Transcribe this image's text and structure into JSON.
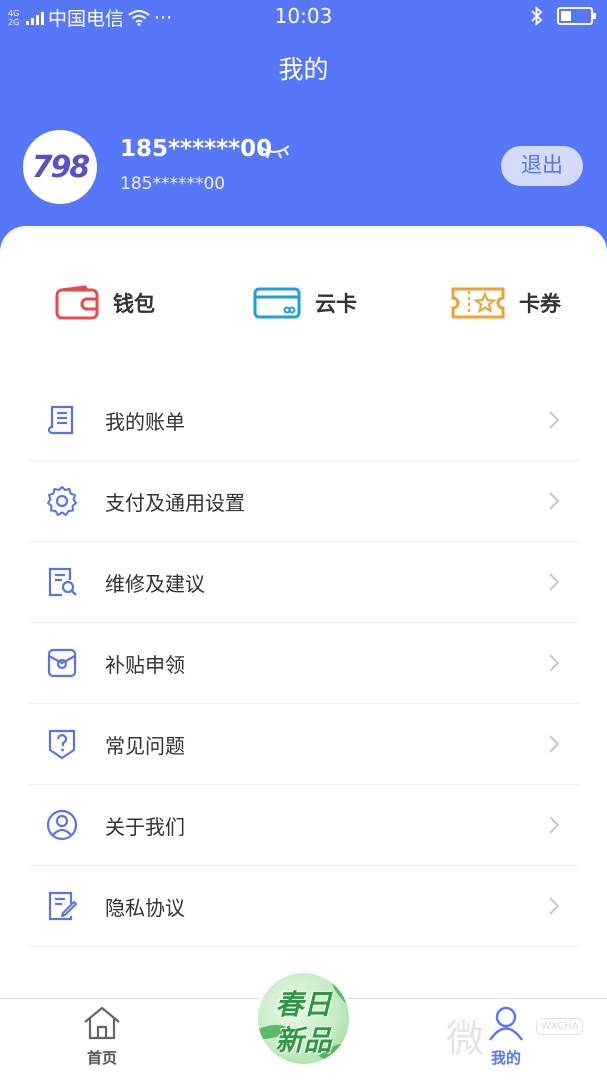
{
  "status_bar": {
    "network_type": "4G 2G",
    "carrier": "中国电信",
    "more": "···",
    "time": "10:03",
    "battery_level": 0.35
  },
  "header": {
    "title": "我的"
  },
  "user": {
    "avatar_text": "798",
    "phone_masked": "185******00",
    "sub_phone": "185******00",
    "logout_label": "退出"
  },
  "quick_actions": [
    {
      "label": "钱包",
      "icon": "wallet-icon",
      "color": "#e94b4b"
    },
    {
      "label": "云卡",
      "icon": "card-icon",
      "color": "#1d9fe0"
    },
    {
      "label": "卡券",
      "icon": "coupon-icon",
      "color": "#f2a12e"
    }
  ],
  "menu": [
    {
      "label": "我的账单",
      "icon": "bill-icon"
    },
    {
      "label": "支付及通用设置",
      "icon": "gear-icon"
    },
    {
      "label": "维修及建议",
      "icon": "repair-icon"
    },
    {
      "label": "补贴申领",
      "icon": "subsidy-icon"
    },
    {
      "label": "常见问题",
      "icon": "question-icon"
    },
    {
      "label": "关于我们",
      "icon": "user-circle-icon"
    },
    {
      "label": "隐私协议",
      "icon": "privacy-doc-icon"
    }
  ],
  "tabbar": {
    "home_label": "首页",
    "mine_label": "我的",
    "promo_line1": "春日",
    "promo_line2": "新品",
    "active_color": "#5677f7"
  },
  "watermark": {
    "text": "微",
    "badge": "WXCHA"
  },
  "colors": {
    "brand_blue": "#5677f7",
    "menu_icon_blue": "#5a74e6"
  }
}
